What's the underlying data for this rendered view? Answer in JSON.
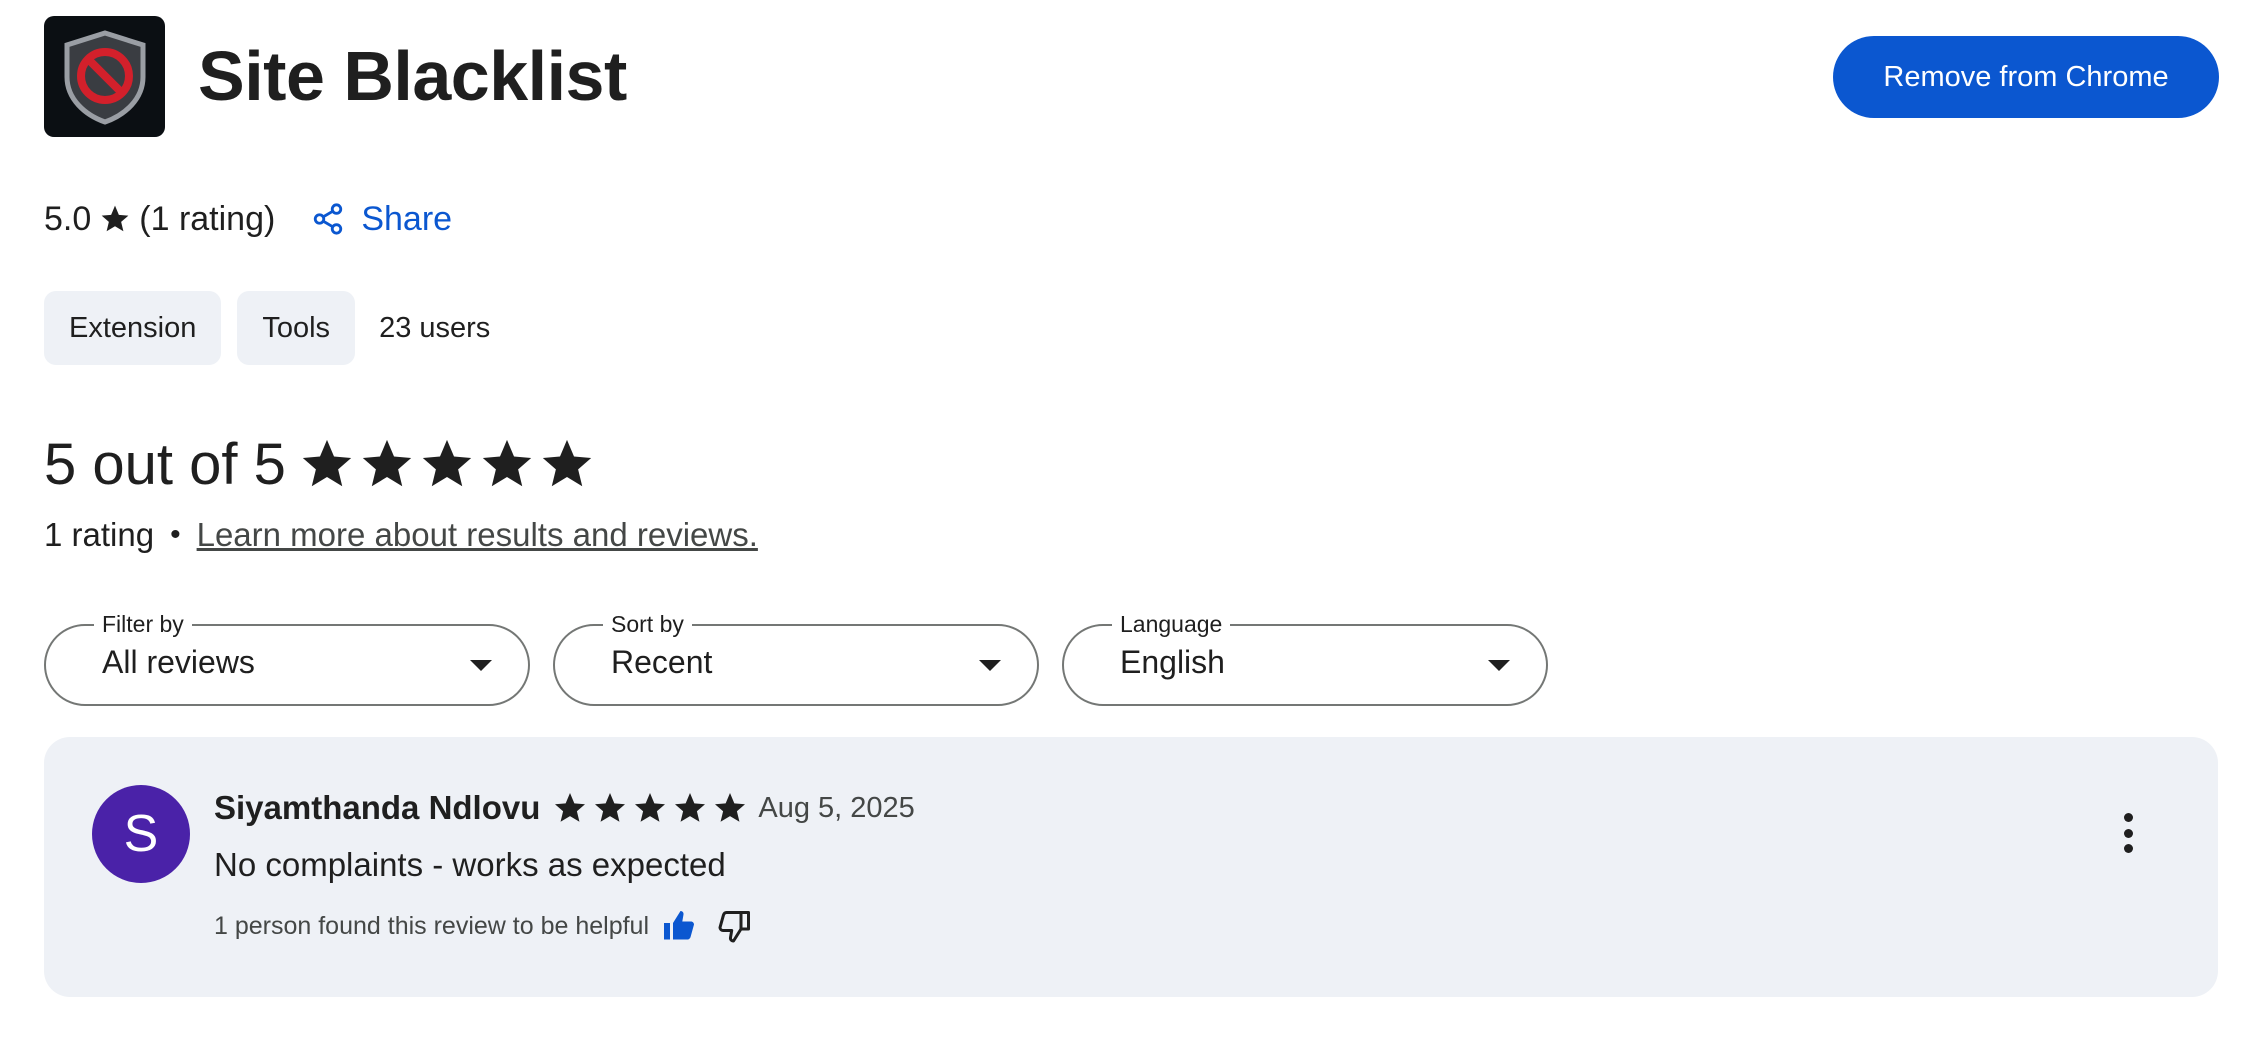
{
  "header": {
    "icon": "shield-blocked-icon",
    "title": "Site Blacklist",
    "remove_label": "Remove from Chrome"
  },
  "rating_summary": {
    "score": "5.0",
    "count_label": "(1 rating)",
    "share_label": "Share",
    "share_icon": "share-icon"
  },
  "chips": [
    "Extension",
    "Tools"
  ],
  "users": "23 users",
  "reviews_summary": {
    "headline": "5 out of 5",
    "stars": 5,
    "rating_count": "1 rating",
    "separator": "•",
    "learn_more": "Learn more about results and reviews."
  },
  "filters": [
    {
      "legend": "Filter by",
      "value": "All reviews"
    },
    {
      "legend": "Sort by",
      "value": "Recent"
    },
    {
      "legend": "Language",
      "value": "English"
    }
  ],
  "review": {
    "avatar_letter": "S",
    "avatar_color": "#4a22a8",
    "author": "Siyamthanda Ndlovu",
    "stars": 5,
    "date": "Aug 5, 2025",
    "text": "No complaints - works as expected",
    "helpful_text": "1 person found this review to be helpful"
  },
  "colors": {
    "accent": "#0b57d0",
    "card_bg": "#eef1f6",
    "icon_bg": "#0b0f13",
    "block_red": "#d3202b"
  }
}
